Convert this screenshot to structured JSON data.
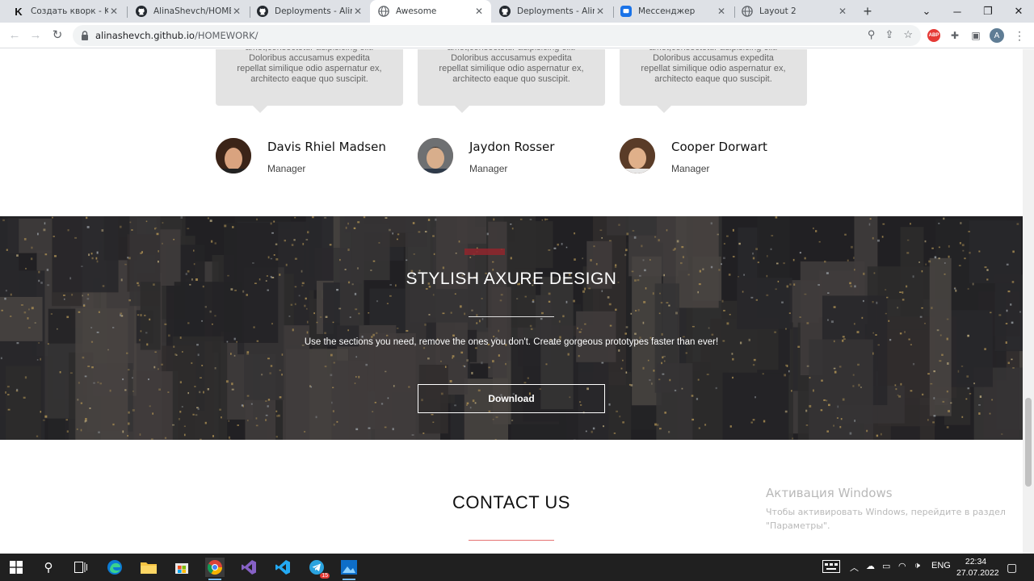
{
  "browser": {
    "tabs": [
      {
        "title": "Создать кворк - Kwork",
        "favicon": "kwork-icon"
      },
      {
        "title": "AlinaShevch/HOMEWORK",
        "favicon": "github-icon"
      },
      {
        "title": "Deployments - AlinaShevch",
        "favicon": "github-icon"
      },
      {
        "title": "Awesome",
        "favicon": "globe-icon",
        "active": true
      },
      {
        "title": "Deployments - AlinaShevch",
        "favicon": "github-icon"
      },
      {
        "title": "Мессенджер",
        "favicon": "messenger-icon"
      },
      {
        "title": "Layout 2",
        "favicon": "globe-icon"
      }
    ],
    "url_host": "alinashevch.github.io",
    "url_path": "/HOMEWORK/",
    "profile_initial": "A",
    "abp_label": "ABP"
  },
  "testimonials": [
    {
      "quote": "amet,consectetur adipisicing elit. Doloribus accusamus expedita repellat similique odio aspernatur ex, architecto eaque quo suscipit.",
      "name": "Davis Rhiel Madsen",
      "role": "Manager"
    },
    {
      "quote": "amet,consectetur adipisicing elit. Doloribus accusamus expedita repellat similique odio aspernatur ex, architecto eaque quo suscipit.",
      "name": "Jaydon Rosser",
      "role": "Manager"
    },
    {
      "quote": "amet,consectetur adipisicing elit. Doloribus accusamus expedita repellat similique odio aspernatur ex, architecto eaque quo suscipit.",
      "name": "Cooper Dorwart",
      "role": "Manager"
    }
  ],
  "hero": {
    "title": "STYLISH AXURE DESIGN",
    "subtitle": "Use the sections you need, remove the ones you don't. Create gorgeous prototypes faster than ever!",
    "button": "Download"
  },
  "contact": {
    "title": "CONTACT US"
  },
  "watermark": {
    "title": "Активация Windows",
    "text": "Чтобы активировать Windows, перейдите в раздел \"Параметры\"."
  },
  "taskbar": {
    "lang": "ENG",
    "time": "22:34",
    "date": "27.07.2022",
    "telegram_badge": "15"
  },
  "colors": {
    "accent_line": "#e57373",
    "bubble_bg": "#e3e3e3",
    "taskbar_bg": "#202020"
  }
}
